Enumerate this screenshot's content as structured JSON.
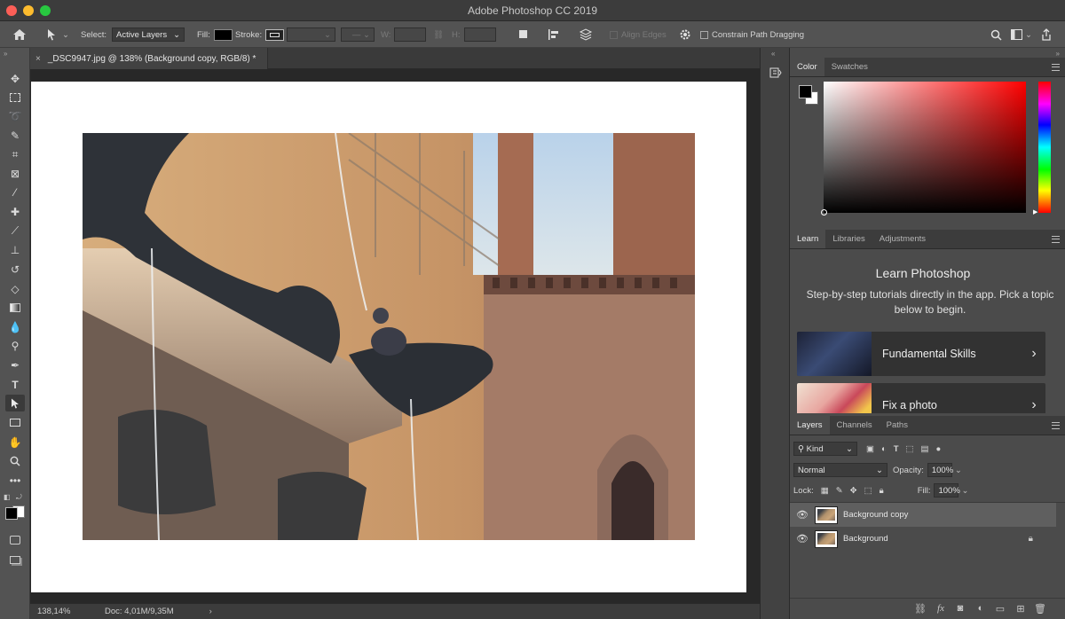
{
  "app": {
    "title": "Adobe Photoshop CC 2019"
  },
  "options": {
    "select_label": "Select:",
    "select_value": "Active Layers",
    "fill_label": "Fill:",
    "stroke_label": "Stroke:",
    "w_label": "W:",
    "h_label": "H:",
    "align_edges": "Align Edges",
    "constrain_path": "Constrain Path Dragging"
  },
  "document": {
    "tab_title": "_DSC9947.jpg @ 138% (Background copy, RGB/8) *",
    "zoom": "138,14%",
    "doc_size": "Doc: 4,01M/9,35M"
  },
  "color_panel": {
    "tabs": [
      "Color",
      "Swatches"
    ],
    "foreground": "#000000",
    "background": "#ffffff"
  },
  "learn_panel": {
    "tabs": [
      "Learn",
      "Libraries",
      "Adjustments"
    ],
    "title": "Learn Photoshop",
    "description": "Step-by-step tutorials directly in the app. Pick a topic below to begin.",
    "cards": [
      {
        "label": "Fundamental Skills"
      },
      {
        "label": "Fix a photo"
      }
    ]
  },
  "layers_panel": {
    "tabs": [
      "Layers",
      "Channels",
      "Paths"
    ],
    "filter_kind": "Kind",
    "blend_mode": "Normal",
    "opacity_label": "Opacity:",
    "opacity_value": "100%",
    "lock_label": "Lock:",
    "fill_label": "Fill:",
    "fill_value": "100%",
    "layers": [
      {
        "name": "Background copy",
        "selected": true,
        "locked": false
      },
      {
        "name": "Background",
        "selected": false,
        "locked": true
      }
    ]
  },
  "icons": {
    "home": "home-icon",
    "move": "move-tool-icon",
    "search": "search-icon",
    "workspace": "workspace-icon",
    "share": "share-icon",
    "settings": "gear-icon"
  }
}
